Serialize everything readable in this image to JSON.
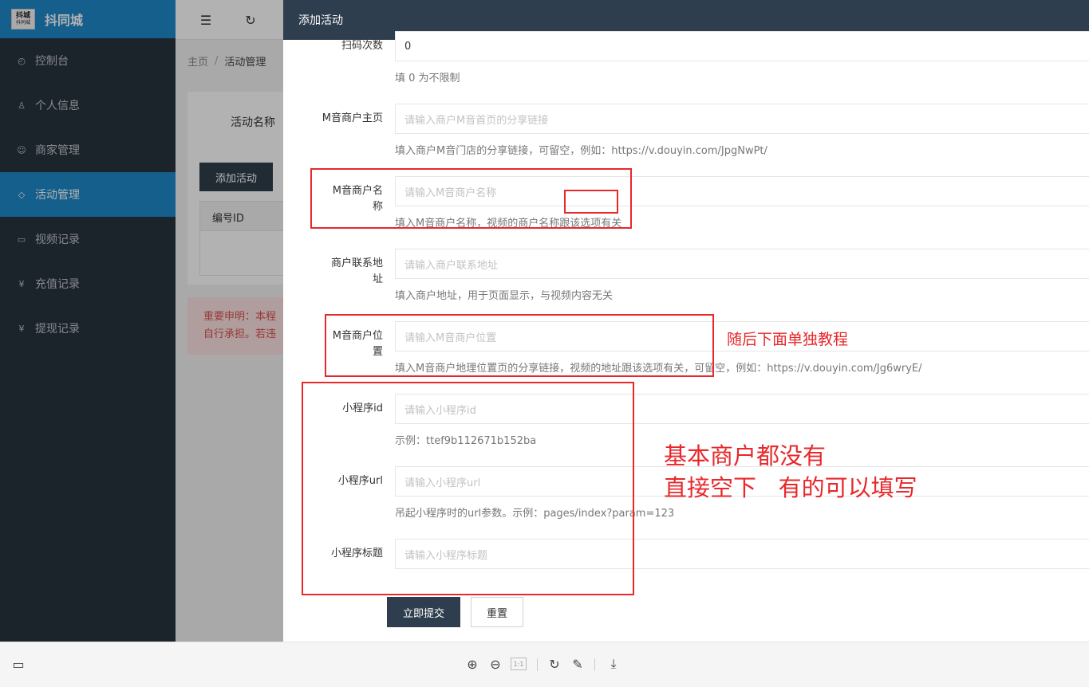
{
  "app": {
    "logo_top": "抖城",
    "logo_bottom": "抖同城",
    "title": "抖同城"
  },
  "sidebar": {
    "items": [
      {
        "label": "控制台",
        "icon": "dashboard-icon"
      },
      {
        "label": "个人信息",
        "icon": "user-icon"
      },
      {
        "label": "商家管理",
        "icon": "smile-icon"
      },
      {
        "label": "活动管理",
        "icon": "tag-icon"
      },
      {
        "label": "视频记录",
        "icon": "video-icon"
      },
      {
        "label": "充值记录",
        "icon": "yen-icon"
      },
      {
        "label": "提现记录",
        "icon": "yen-icon"
      }
    ]
  },
  "breadcrumb": {
    "home": "主页",
    "sep": "/",
    "current": "活动管理"
  },
  "list": {
    "search_label": "活动名称",
    "add_button": "添加活动",
    "col_id": "编号ID"
  },
  "notice": {
    "line1": "重要申明：本程",
    "line2": "自行承担。若违"
  },
  "drawer": {
    "title": "添加活动",
    "fields": {
      "scan_count": {
        "label": "扫码次数",
        "value": "0",
        "help": "填 0 为不限制"
      },
      "merchant_home": {
        "label": "M音商户主页",
        "placeholder": "请输入商户M音首页的分享链接",
        "help": "填入商户M音门店的分享链接，可留空，例如：https://v.douyin.com/JpgNwPt/"
      },
      "merchant_name": {
        "label": "M音商户名称",
        "placeholder": "请输入M音商户名称",
        "help": "填入M音商户名称，视频的商户名称跟该选项有关"
      },
      "merchant_address": {
        "label": "商户联系地址",
        "placeholder": "请输入商户联系地址",
        "help": "填入商户地址，用于页面显示，与视频内容无关"
      },
      "merchant_location": {
        "label": "M音商户位置",
        "placeholder": "请输入M音商户位置",
        "help": "填入M音商户地理位置页的分享链接，视频的地址跟该选项有关，可留空，例如：https://v.douyin.com/Jg6wryE/"
      },
      "mini_id": {
        "label": "小程序id",
        "placeholder": "请输入小程序id",
        "help": "示例：ttef9b112671b152ba"
      },
      "mini_url": {
        "label": "小程序url",
        "placeholder": "请输入小程序url",
        "help": "吊起小程序时的url参数。示例：pages/index?param=123"
      },
      "mini_title": {
        "label": "小程序标题",
        "placeholder": "请输入小程序标题"
      }
    },
    "submit_label": "立即提交",
    "reset_label": "重置"
  },
  "annotations": {
    "location_note": "随后下面单独教程",
    "mini_note_line1": "基本商户都没有",
    "mini_note_line2": "直接空下   有的可以填写",
    "color": "#e8282b"
  },
  "viewer": {
    "icons": [
      "monitor-icon",
      "zoom-in-icon",
      "zoom-out-icon",
      "actual-size-icon",
      "rotate-icon",
      "edit-icon",
      "download-icon"
    ],
    "actual_size_label": "1:1"
  },
  "colors": {
    "brand_blue": "#1e88c9",
    "sidebar_bg": "#28333e",
    "drawer_header": "#2f3e4e"
  }
}
